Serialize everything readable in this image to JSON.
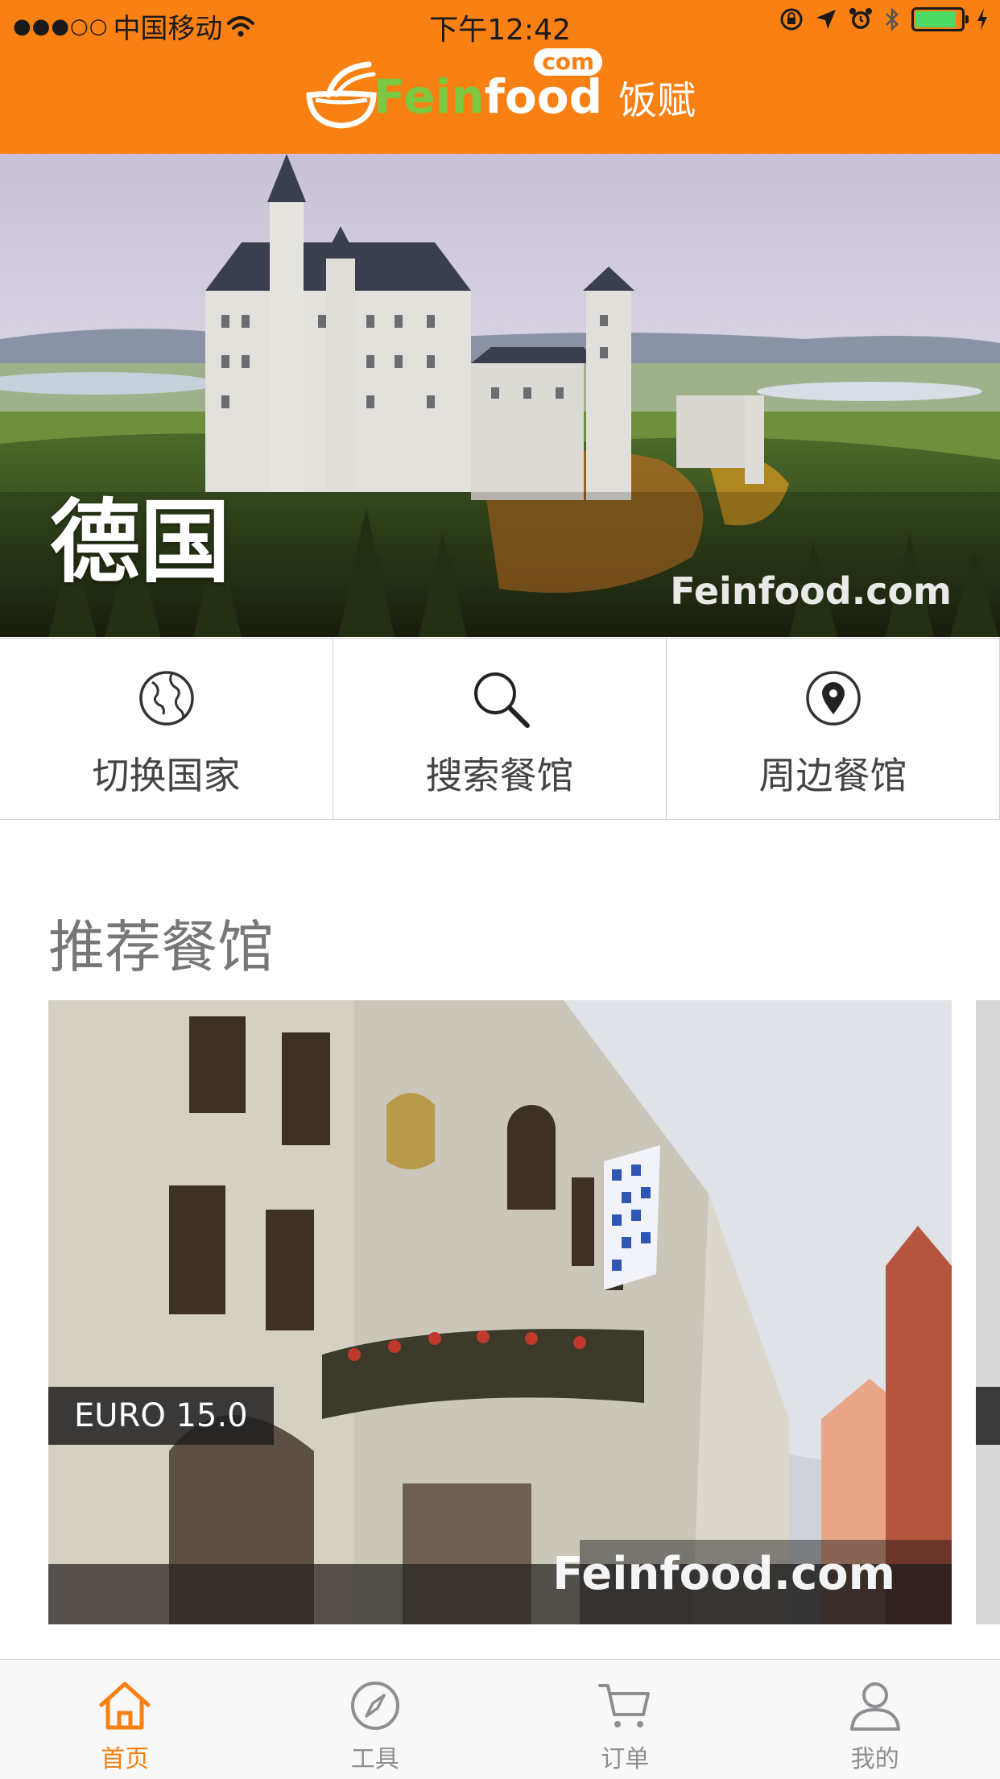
{
  "status_bar": {
    "signal_dots": "●●●○○",
    "carrier": "中国移动",
    "time": "下午12:42",
    "battery_level": 0.9
  },
  "header": {
    "logo_fein": "Fein",
    "logo_food": "food",
    "logo_com": "com",
    "logo_cn": "饭赋"
  },
  "hero": {
    "title": "德国",
    "watermark": "Feinfood.com"
  },
  "actions": [
    {
      "label": "切换国家",
      "icon": "globe-icon"
    },
    {
      "label": "搜索餐馆",
      "icon": "search-icon"
    },
    {
      "label": "周边餐馆",
      "icon": "location-pin-icon"
    }
  ],
  "recommended": {
    "section_title": "推荐餐馆",
    "cards": [
      {
        "price": "EURO 15.0",
        "watermark": "Feinfood.com"
      }
    ]
  },
  "tabbar": {
    "tabs": [
      {
        "label": "首页",
        "icon": "home-icon",
        "active": true
      },
      {
        "label": "工具",
        "icon": "compass-icon",
        "active": false
      },
      {
        "label": "订单",
        "icon": "cart-icon",
        "active": false
      },
      {
        "label": "我的",
        "icon": "user-icon",
        "active": false
      }
    ]
  },
  "colors": {
    "accent": "#f98013",
    "logo_green": "#7ac943",
    "inactive_tab": "#8e8e93"
  }
}
